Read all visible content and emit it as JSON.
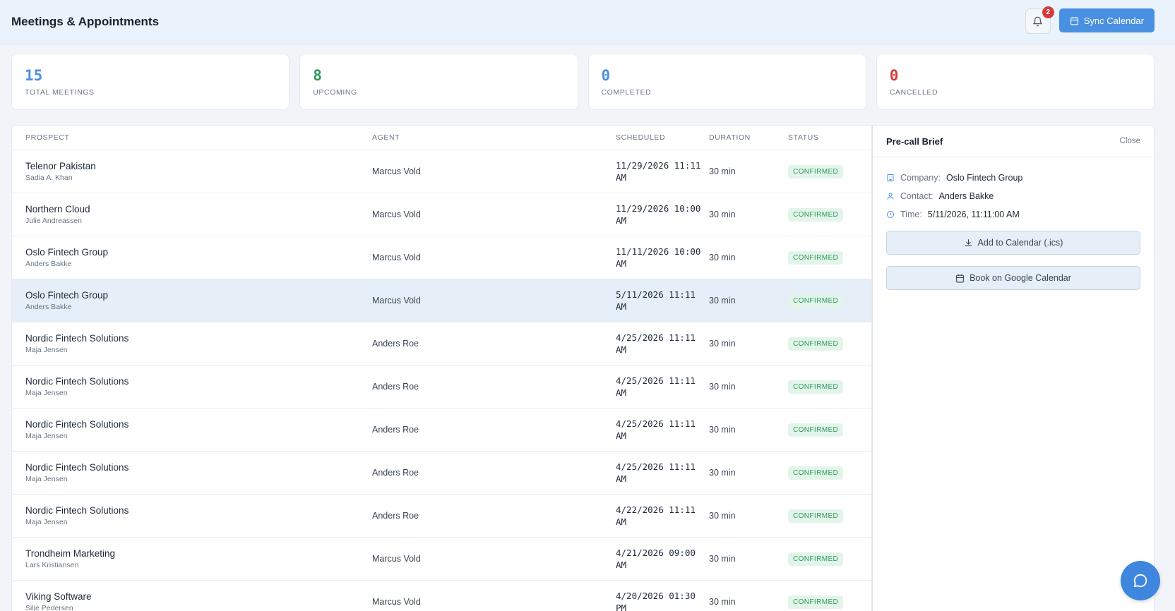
{
  "header": {
    "title": "Meetings & Appointments",
    "notification_count": "2",
    "sync_label": "Sync Calendar"
  },
  "stats": [
    {
      "value": "15",
      "label": "TOTAL MEETINGS",
      "color": "#4a90e2"
    },
    {
      "value": "8",
      "label": "UPCOMING",
      "color": "#2e9a58"
    },
    {
      "value": "0",
      "label": "COMPLETED",
      "color": "#4a90e2"
    },
    {
      "value": "0",
      "label": "CANCELLED",
      "color": "#d63b3b"
    }
  ],
  "table": {
    "columns": [
      "PROSPECT",
      "AGENT",
      "SCHEDULED",
      "DURATION",
      "STATUS"
    ],
    "rows": [
      {
        "prospect": "Telenor Pakistan",
        "contact": "Sadia A. Khan",
        "agent": "Marcus Vold",
        "date": "11/29/2026 11:11",
        "time": "AM",
        "duration": "30 min",
        "status": "CONFIRMED"
      },
      {
        "prospect": "Northern Cloud",
        "contact": "Julie Andreassen",
        "agent": "Marcus Vold",
        "date": "11/29/2026 10:00",
        "time": "AM",
        "duration": "30 min",
        "status": "CONFIRMED"
      },
      {
        "prospect": "Oslo Fintech Group",
        "contact": "Anders Bakke",
        "agent": "Marcus Vold",
        "date": "11/11/2026 10:00",
        "time": "AM",
        "duration": "30 min",
        "status": "CONFIRMED"
      },
      {
        "prospect": "Oslo Fintech Group",
        "contact": "Anders Bakke",
        "agent": "Marcus Vold",
        "date": "5/11/2026 11:11",
        "time": "AM",
        "duration": "30 min",
        "status": "CONFIRMED"
      },
      {
        "prospect": "Nordic Fintech Solutions",
        "contact": "Maja Jensen",
        "agent": "Anders Roe",
        "date": "4/25/2026 11:11",
        "time": "AM",
        "duration": "30 min",
        "status": "CONFIRMED"
      },
      {
        "prospect": "Nordic Fintech Solutions",
        "contact": "Maja Jensen",
        "agent": "Anders Roe",
        "date": "4/25/2026 11:11",
        "time": "AM",
        "duration": "30 min",
        "status": "CONFIRMED"
      },
      {
        "prospect": "Nordic Fintech Solutions",
        "contact": "Maja Jensen",
        "agent": "Anders Roe",
        "date": "4/25/2026 11:11",
        "time": "AM",
        "duration": "30 min",
        "status": "CONFIRMED"
      },
      {
        "prospect": "Nordic Fintech Solutions",
        "contact": "Maja Jensen",
        "agent": "Anders Roe",
        "date": "4/25/2026 11:11",
        "time": "AM",
        "duration": "30 min",
        "status": "CONFIRMED"
      },
      {
        "prospect": "Nordic Fintech Solutions",
        "contact": "Maja Jensen",
        "agent": "Anders Roe",
        "date": "4/22/2026 11:11",
        "time": "AM",
        "duration": "30 min",
        "status": "CONFIRMED"
      },
      {
        "prospect": "Trondheim Marketing",
        "contact": "Lars Kristiansen",
        "agent": "Marcus Vold",
        "date": "4/21/2026 09:00",
        "time": "AM",
        "duration": "30 min",
        "status": "CONFIRMED"
      },
      {
        "prospect": "Viking Software",
        "contact": "Silje Pedersen",
        "agent": "Marcus Vold",
        "date": "4/20/2026 01:30",
        "time": "PM",
        "duration": "30 min",
        "status": "CONFIRMED"
      }
    ]
  },
  "brief": {
    "title": "Pre-call Brief",
    "close_label": "Close",
    "company_label": "Company:",
    "company": "Oslo Fintech Group",
    "contact_label": "Contact:",
    "contact": "Anders Bakke",
    "time_label": "Time:",
    "time": "5/11/2026, 11:11:00 AM",
    "ics_label": "Add to Calendar (.ics)",
    "google_label": "Book on Google Calendar"
  }
}
